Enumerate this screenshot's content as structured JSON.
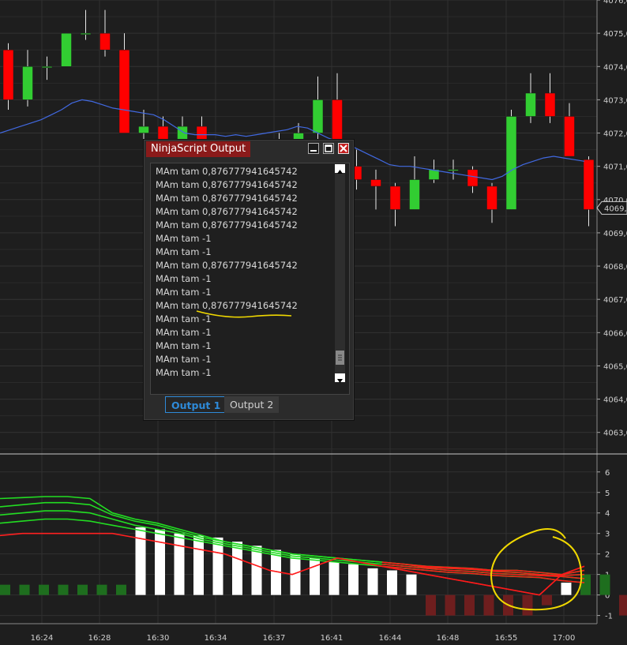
{
  "window": {
    "title": "NinjaScript Output",
    "tabs": [
      {
        "label": "Output 1",
        "active": true
      },
      {
        "label": "Output 2",
        "active": false
      }
    ],
    "log": [
      "MAm tam 0,876777941645742",
      "MAm tam 0,876777941645742",
      "MAm tam 0,876777941645742",
      "MAm tam 0,876777941645742",
      "MAm tam 0,876777941645742",
      "MAm tam -1",
      "MAm tam -1",
      "MAm tam 0,876777941645742",
      "MAm tam -1",
      "MAm tam -1",
      "MAm tam 0,876777941645742",
      "MAm tam -1",
      "MAm tam -1",
      "MAm tam -1",
      "MAm tam -1",
      "MAm tam -1"
    ]
  },
  "price_axis": {
    "ticks": [
      "4076,0",
      "4075,0",
      "4074,0",
      "4073,0",
      "4072,0",
      "4071,0",
      "4070,0",
      "4069,0",
      "4068,0",
      "4067,0",
      "4066,0",
      "4065,0",
      "4064,0",
      "4063,0"
    ],
    "current_price": "4069,75",
    "current_price_label": "4069,7"
  },
  "indicator_axis": {
    "ticks": [
      "6",
      "5",
      "4",
      "3",
      "2",
      "1",
      "0",
      "-1"
    ]
  },
  "time_axis": {
    "ticks": [
      "16:24",
      "16:28",
      "16:30",
      "16:34",
      "16:37",
      "16:41",
      "16:44",
      "16:48",
      "16:55",
      "17:00"
    ]
  },
  "colors": {
    "up": "#32cd32",
    "down": "#ff0000",
    "ma": "#4169e1",
    "histo_green": "#1e6e1e",
    "histo_red": "#6e1e1e",
    "histo_white": "#ffffff",
    "annotation": "#f0d800"
  },
  "chart_data": {
    "type": "candlestick",
    "price_scale": {
      "min": 4062.4,
      "max": 4076.0
    },
    "candles": [
      {
        "o": 4074.5,
        "h": 4074.7,
        "l": 4072.7,
        "c": 4073.0
      },
      {
        "o": 4073.0,
        "h": 4074.5,
        "l": 4072.8,
        "c": 4074.0
      },
      {
        "o": 4074.0,
        "h": 4074.3,
        "l": 4073.6,
        "c": 4074.0
      },
      {
        "o": 4074.0,
        "h": 4075.0,
        "l": 4074.0,
        "c": 4075.0
      },
      {
        "o": 4075.0,
        "h": 4075.7,
        "l": 4074.8,
        "c": 4075.0
      },
      {
        "o": 4075.0,
        "h": 4075.7,
        "l": 4074.3,
        "c": 4074.5
      },
      {
        "o": 4074.5,
        "h": 4075.0,
        "l": 4072.0,
        "c": 4072.0
      },
      {
        "o": 4072.0,
        "h": 4072.7,
        "l": 4071.5,
        "c": 4072.2
      },
      {
        "o": 4072.2,
        "h": 4072.5,
        "l": 4070.5,
        "c": 4070.5
      },
      {
        "o": 4070.5,
        "h": 4072.5,
        "l": 4070.3,
        "c": 4072.2
      },
      {
        "o": 4072.2,
        "h": 4072.5,
        "l": 4070.5,
        "c": 4071.0
      },
      {
        "o": 4071.0,
        "h": 4071.5,
        "l": 4070.5,
        "c": 4070.8
      },
      {
        "o": 4070.8,
        "h": 4071.5,
        "l": 4070.5,
        "c": 4071.2
      },
      {
        "o": 4071.2,
        "h": 4071.8,
        "l": 4070.5,
        "c": 4071.0
      },
      {
        "o": 4071.0,
        "h": 4072.0,
        "l": 4070.3,
        "c": 4071.5
      },
      {
        "o": 4071.5,
        "h": 4072.3,
        "l": 4071.0,
        "c": 4072.0
      },
      {
        "o": 4072.0,
        "h": 4073.7,
        "l": 4071.8,
        "c": 4073.0
      },
      {
        "o": 4073.0,
        "h": 4073.8,
        "l": 4070.8,
        "c": 4071.0
      },
      {
        "o": 4071.0,
        "h": 4071.5,
        "l": 4070.3,
        "c": 4070.6
      },
      {
        "o": 4070.6,
        "h": 4070.9,
        "l": 4069.7,
        "c": 4070.4
      },
      {
        "o": 4070.4,
        "h": 4070.5,
        "l": 4069.2,
        "c": 4069.7
      },
      {
        "o": 4069.7,
        "h": 4071.3,
        "l": 4069.7,
        "c": 4070.6
      },
      {
        "o": 4070.6,
        "h": 4071.2,
        "l": 4070.5,
        "c": 4070.9
      },
      {
        "o": 4070.9,
        "h": 4071.2,
        "l": 4070.6,
        "c": 4070.9
      },
      {
        "o": 4070.9,
        "h": 4071.0,
        "l": 4070.2,
        "c": 4070.4
      },
      {
        "o": 4070.4,
        "h": 4070.5,
        "l": 4069.3,
        "c": 4069.7
      },
      {
        "o": 4069.7,
        "h": 4072.7,
        "l": 4069.7,
        "c": 4072.5
      },
      {
        "o": 4072.5,
        "h": 4073.8,
        "l": 4072.3,
        "c": 4073.2
      },
      {
        "o": 4073.2,
        "h": 4073.8,
        "l": 4072.3,
        "c": 4072.5
      },
      {
        "o": 4072.5,
        "h": 4072.9,
        "l": 4071.3,
        "c": 4071.3
      },
      {
        "o": 4071.2,
        "h": 4071.3,
        "l": 4069.2,
        "c": 4069.7
      }
    ],
    "moving_average": [
      4072.0,
      4072.1,
      4072.2,
      4072.3,
      4072.4,
      4072.55,
      4072.7,
      4072.9,
      4073.0,
      4072.95,
      4072.85,
      4072.75,
      4072.7,
      4072.65,
      4072.6,
      4072.55,
      4072.4,
      4072.2,
      4072.0,
      4071.95,
      4071.95,
      4071.95,
      4071.9,
      4071.95,
      4071.9,
      4071.95,
      4072.0,
      4072.05,
      4072.1,
      4072.2,
      4072.15,
      4072.0,
      4071.85,
      4071.75,
      4071.65,
      4071.5,
      4071.35,
      4071.2,
      4071.05,
      4071.0,
      4071.0,
      4070.95,
      4070.9,
      4070.85,
      4070.8,
      4070.75,
      4070.7,
      4070.65,
      4070.6,
      4070.7,
      4070.9,
      4071.05,
      4071.15,
      4071.25,
      4071.3,
      4071.25,
      4071.2,
      4071.15
    ],
    "indicator_scale": {
      "min": -1.4,
      "max": 6.8
    },
    "histogram": [
      0.5,
      0.5,
      0.5,
      0.5,
      0.5,
      0.5,
      0.5,
      3.3,
      3.2,
      3.0,
      2.9,
      2.8,
      2.6,
      2.4,
      2.2,
      2.0,
      1.8,
      1.6,
      1.5,
      1.3,
      1.2,
      1.0,
      -1.0,
      -1.0,
      -1.0,
      -1.0,
      -1.0,
      -1.0,
      -0.5,
      0.6,
      1.0,
      1.0,
      -1.0
    ],
    "histogram_colors": [
      "g",
      "g",
      "g",
      "g",
      "g",
      "g",
      "g",
      "w",
      "w",
      "w",
      "w",
      "w",
      "w",
      "w",
      "w",
      "w",
      "w",
      "w",
      "w",
      "w",
      "w",
      "w",
      "r",
      "r",
      "r",
      "r",
      "r",
      "r",
      "r",
      "w",
      "g",
      "g",
      "r"
    ],
    "oscillator_lines": [
      [
        4.7,
        4.75,
        4.8,
        4.8,
        4.7,
        4.0,
        3.7,
        3.5,
        3.2,
        2.9,
        2.6,
        2.4,
        2.2,
        2.0,
        1.9,
        1.8,
        1.7,
        1.6,
        1.5,
        1.4,
        1.35,
        1.3,
        1.2,
        1.2,
        1.1,
        1.0,
        1.2
      ],
      [
        4.3,
        4.4,
        4.5,
        4.5,
        4.4,
        3.9,
        3.6,
        3.4,
        3.1,
        2.8,
        2.6,
        2.4,
        2.2,
        2.0,
        1.9,
        1.8,
        1.7,
        1.6,
        1.5,
        1.35,
        1.3,
        1.25,
        1.15,
        1.1,
        1.0,
        0.95,
        1.0
      ],
      [
        3.9,
        4.0,
        4.1,
        4.1,
        4.0,
        3.7,
        3.4,
        3.2,
        3.0,
        2.7,
        2.5,
        2.3,
        2.1,
        1.9,
        1.8,
        1.7,
        1.6,
        1.5,
        1.4,
        1.3,
        1.2,
        1.15,
        1.05,
        1.0,
        0.95,
        0.9,
        0.8
      ],
      [
        3.5,
        3.6,
        3.7,
        3.7,
        3.6,
        3.4,
        3.2,
        3.0,
        2.8,
        2.6,
        2.4,
        2.2,
        2.0,
        1.8,
        1.7,
        1.6,
        1.5,
        1.4,
        1.3,
        1.2,
        1.1,
        1.05,
        0.95,
        0.9,
        0.85,
        0.7,
        0.6
      ],
      [
        2.9,
        3.0,
        3.0,
        3.0,
        3.0,
        3.0,
        2.8,
        2.6,
        2.4,
        2.2,
        2.0,
        1.6,
        1.2,
        1.0,
        1.4,
        1.8,
        1.6,
        1.4,
        1.2,
        1.0,
        0.8,
        0.6,
        0.4,
        0.2,
        0.0,
        1.0,
        1.4
      ]
    ]
  }
}
